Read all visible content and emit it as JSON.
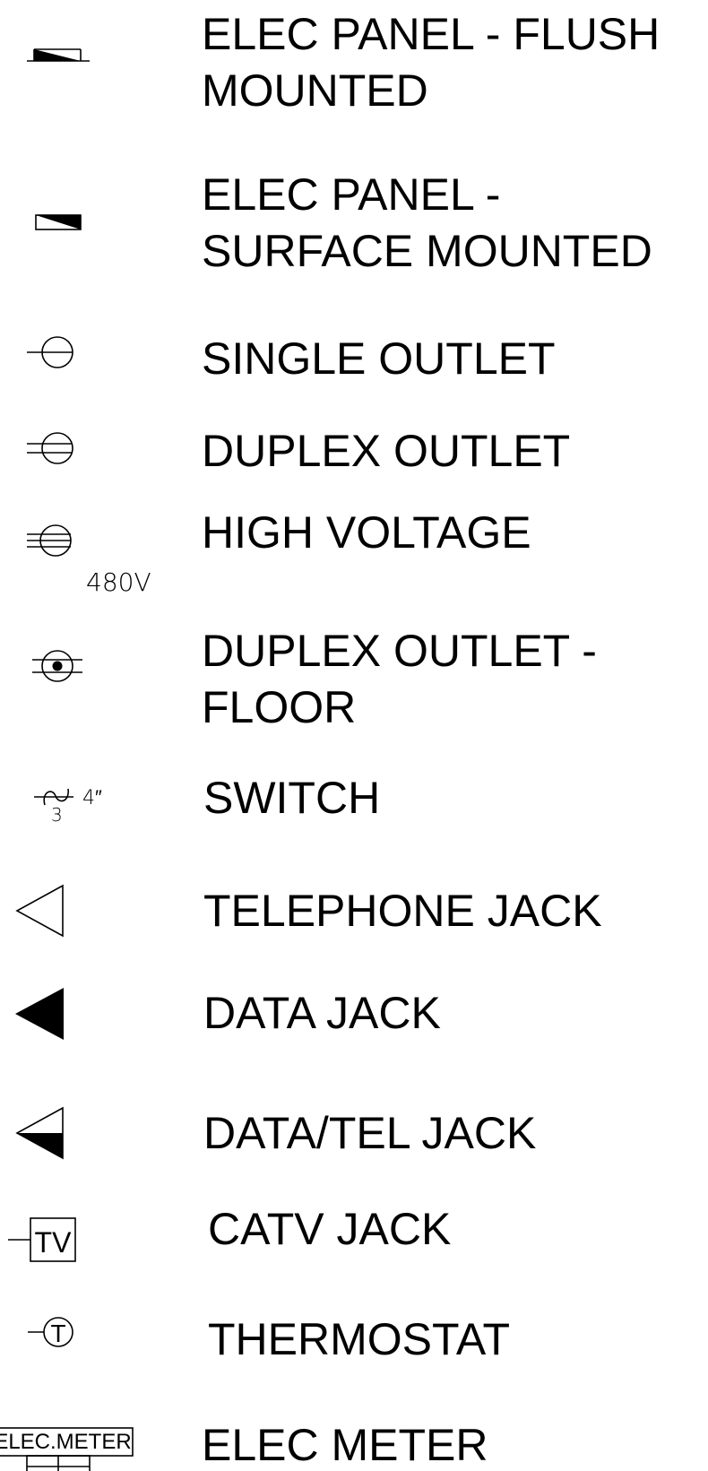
{
  "legend": {
    "items": [
      {
        "id": "elec-panel-flush",
        "symbol": "panel-flush-icon",
        "lines": [
          "ELEC PANEL - FLUSH",
          "MOUNTED"
        ]
      },
      {
        "id": "elec-panel-surface",
        "symbol": "panel-surface-icon",
        "lines": [
          "ELEC PANEL -",
          "SURFACE MOUNTED"
        ]
      },
      {
        "id": "single-outlet",
        "symbol": "single-outlet-icon",
        "lines": [
          "SINGLE OUTLET"
        ]
      },
      {
        "id": "duplex-outlet",
        "symbol": "duplex-outlet-icon",
        "lines": [
          "DUPLEX OUTLET"
        ]
      },
      {
        "id": "high-voltage",
        "symbol": "high-voltage-outlet-icon",
        "lines": [
          "HIGH VOLTAGE"
        ],
        "symbol_text": "480V"
      },
      {
        "id": "duplex-outlet-floor",
        "symbol": "floor-outlet-icon",
        "lines": [
          "DUPLEX OUTLET -",
          "FLOOR"
        ]
      },
      {
        "id": "switch",
        "symbol": "switch-icon",
        "lines": [
          "SWITCH"
        ],
        "symbol_text": "4″",
        "symbol_subtext": "3"
      },
      {
        "id": "telephone-jack",
        "symbol": "telephone-jack-icon",
        "lines": [
          "TELEPHONE JACK"
        ]
      },
      {
        "id": "data-jack",
        "symbol": "data-jack-icon",
        "lines": [
          "DATA JACK"
        ]
      },
      {
        "id": "data-tel-jack",
        "symbol": "data-tel-jack-icon",
        "lines": [
          "DATA/TEL JACK"
        ]
      },
      {
        "id": "catv-jack",
        "symbol": "catv-jack-icon",
        "lines": [
          "CATV JACK"
        ],
        "symbol_text": "TV"
      },
      {
        "id": "thermostat",
        "symbol": "thermostat-icon",
        "lines": [
          "THERMOSTAT"
        ],
        "symbol_text": "T"
      },
      {
        "id": "elec-meter",
        "symbol": "elec-meter-icon",
        "lines": [
          "ELEC METER"
        ],
        "symbol_text": "ELEC.METER"
      }
    ]
  }
}
